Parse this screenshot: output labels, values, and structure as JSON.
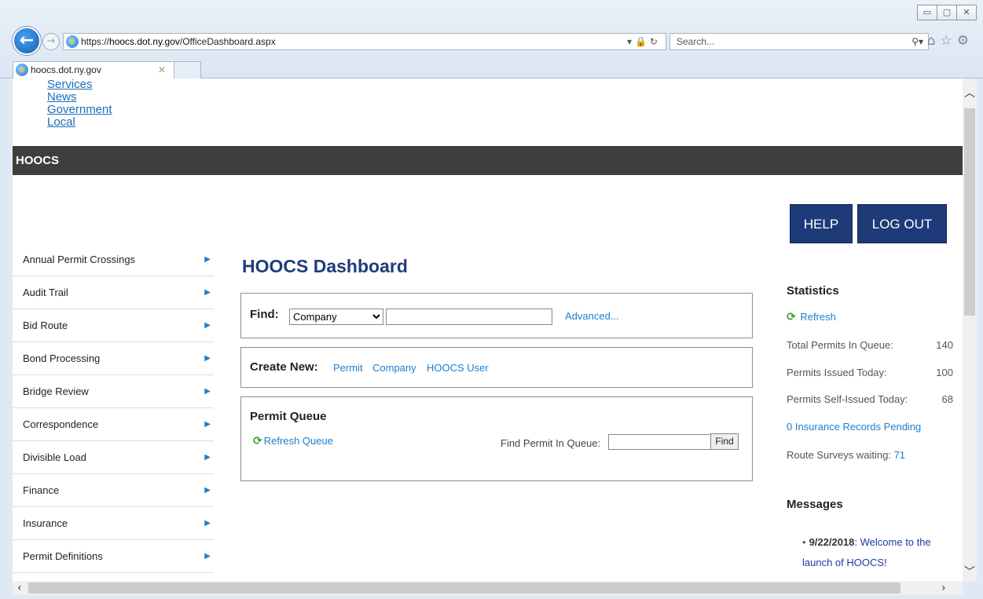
{
  "browser": {
    "url_prefix": "https://",
    "url_host": "hoocs.dot.ny.gov",
    "url_path": "/OfficeDashboard.aspx",
    "search_placeholder": "Search...",
    "tab_title": "hoocs.dot.ny.gov"
  },
  "top_nav": [
    "Services",
    "News",
    "Government",
    "Local"
  ],
  "banner": {
    "title": "HOOCS"
  },
  "header_buttons": {
    "help": "HELP",
    "logout": "LOG OUT"
  },
  "sidebar": {
    "items": [
      "Annual Permit Crossings",
      "Audit Trail",
      "Bid Route",
      "Bond Processing",
      "Bridge Review",
      "Correspondence",
      "Divisible Load",
      "Finance",
      "Insurance",
      "Permit Definitions"
    ]
  },
  "dashboard": {
    "title": "HOOCS Dashboard",
    "find": {
      "label": "Find:",
      "selected_option": "Company",
      "search_value": "",
      "advanced_link": "Advanced..."
    },
    "create_new": {
      "label": "Create New:",
      "links": [
        "Permit",
        "Company",
        "HOOCS User"
      ]
    },
    "permit_queue": {
      "title": "Permit Queue",
      "refresh_label": "Refresh Queue",
      "find_label": "Find Permit In Queue:",
      "find_value": "",
      "find_button": "Find"
    }
  },
  "statistics": {
    "title": "Statistics",
    "refresh_label": "Refresh",
    "rows": [
      {
        "label": "Total Permits In Queue:",
        "value": "140"
      },
      {
        "label": "Permits Issued Today:",
        "value": "100"
      },
      {
        "label": "Permits Self-Issued Today:",
        "value": "68"
      }
    ],
    "insurance_link": "0 Insurance Records Pending",
    "route_surveys_label": "Route Surveys waiting:",
    "route_surveys_value": "71"
  },
  "messages": {
    "title": "Messages",
    "items": [
      {
        "date": "9/22/2018",
        "text": "Welcome to the launch of HOOCS!"
      }
    ]
  }
}
